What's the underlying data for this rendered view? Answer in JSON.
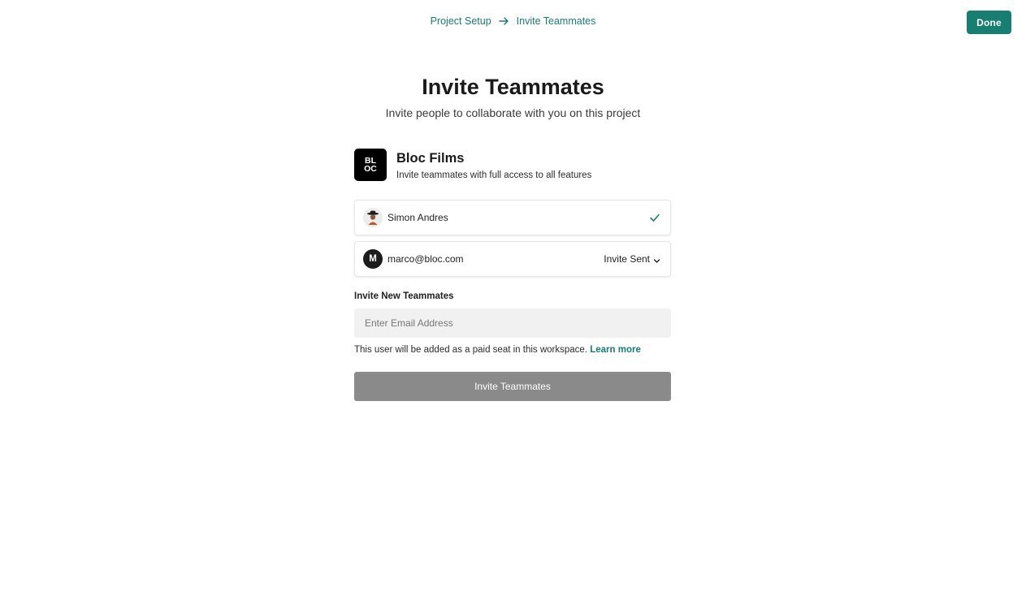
{
  "breadcrumb": {
    "items": [
      "Project Setup",
      "Invite Teammates"
    ],
    "separator_icon": "arrow-right-icon"
  },
  "header": {
    "done_label": "Done"
  },
  "page": {
    "title": "Invite Teammates",
    "subtitle": "Invite people to collaborate with you on this project"
  },
  "organization": {
    "logo_text": "BL\nOC",
    "name": "Bloc Films",
    "description": "Invite teammates with full access to all features"
  },
  "members": [
    {
      "name": "Simon Andres",
      "avatar": "photo",
      "status_icon": "check-icon"
    },
    {
      "name": "marco@bloc.com",
      "avatar_initial": "M",
      "status_label": "Invite Sent"
    }
  ],
  "invite": {
    "section_label": "Invite New Teammates",
    "email_placeholder": "Enter Email Address",
    "email_value": "",
    "note": "This user will be added as a paid seat in this workspace.",
    "learn_more": "Learn more",
    "button_label": "Invite Teammates"
  },
  "colors": {
    "accent": "#177e72",
    "button_disabled": "#8a8a8a",
    "input_bg": "#f1f1f1",
    "logo_bg": "#000000"
  }
}
